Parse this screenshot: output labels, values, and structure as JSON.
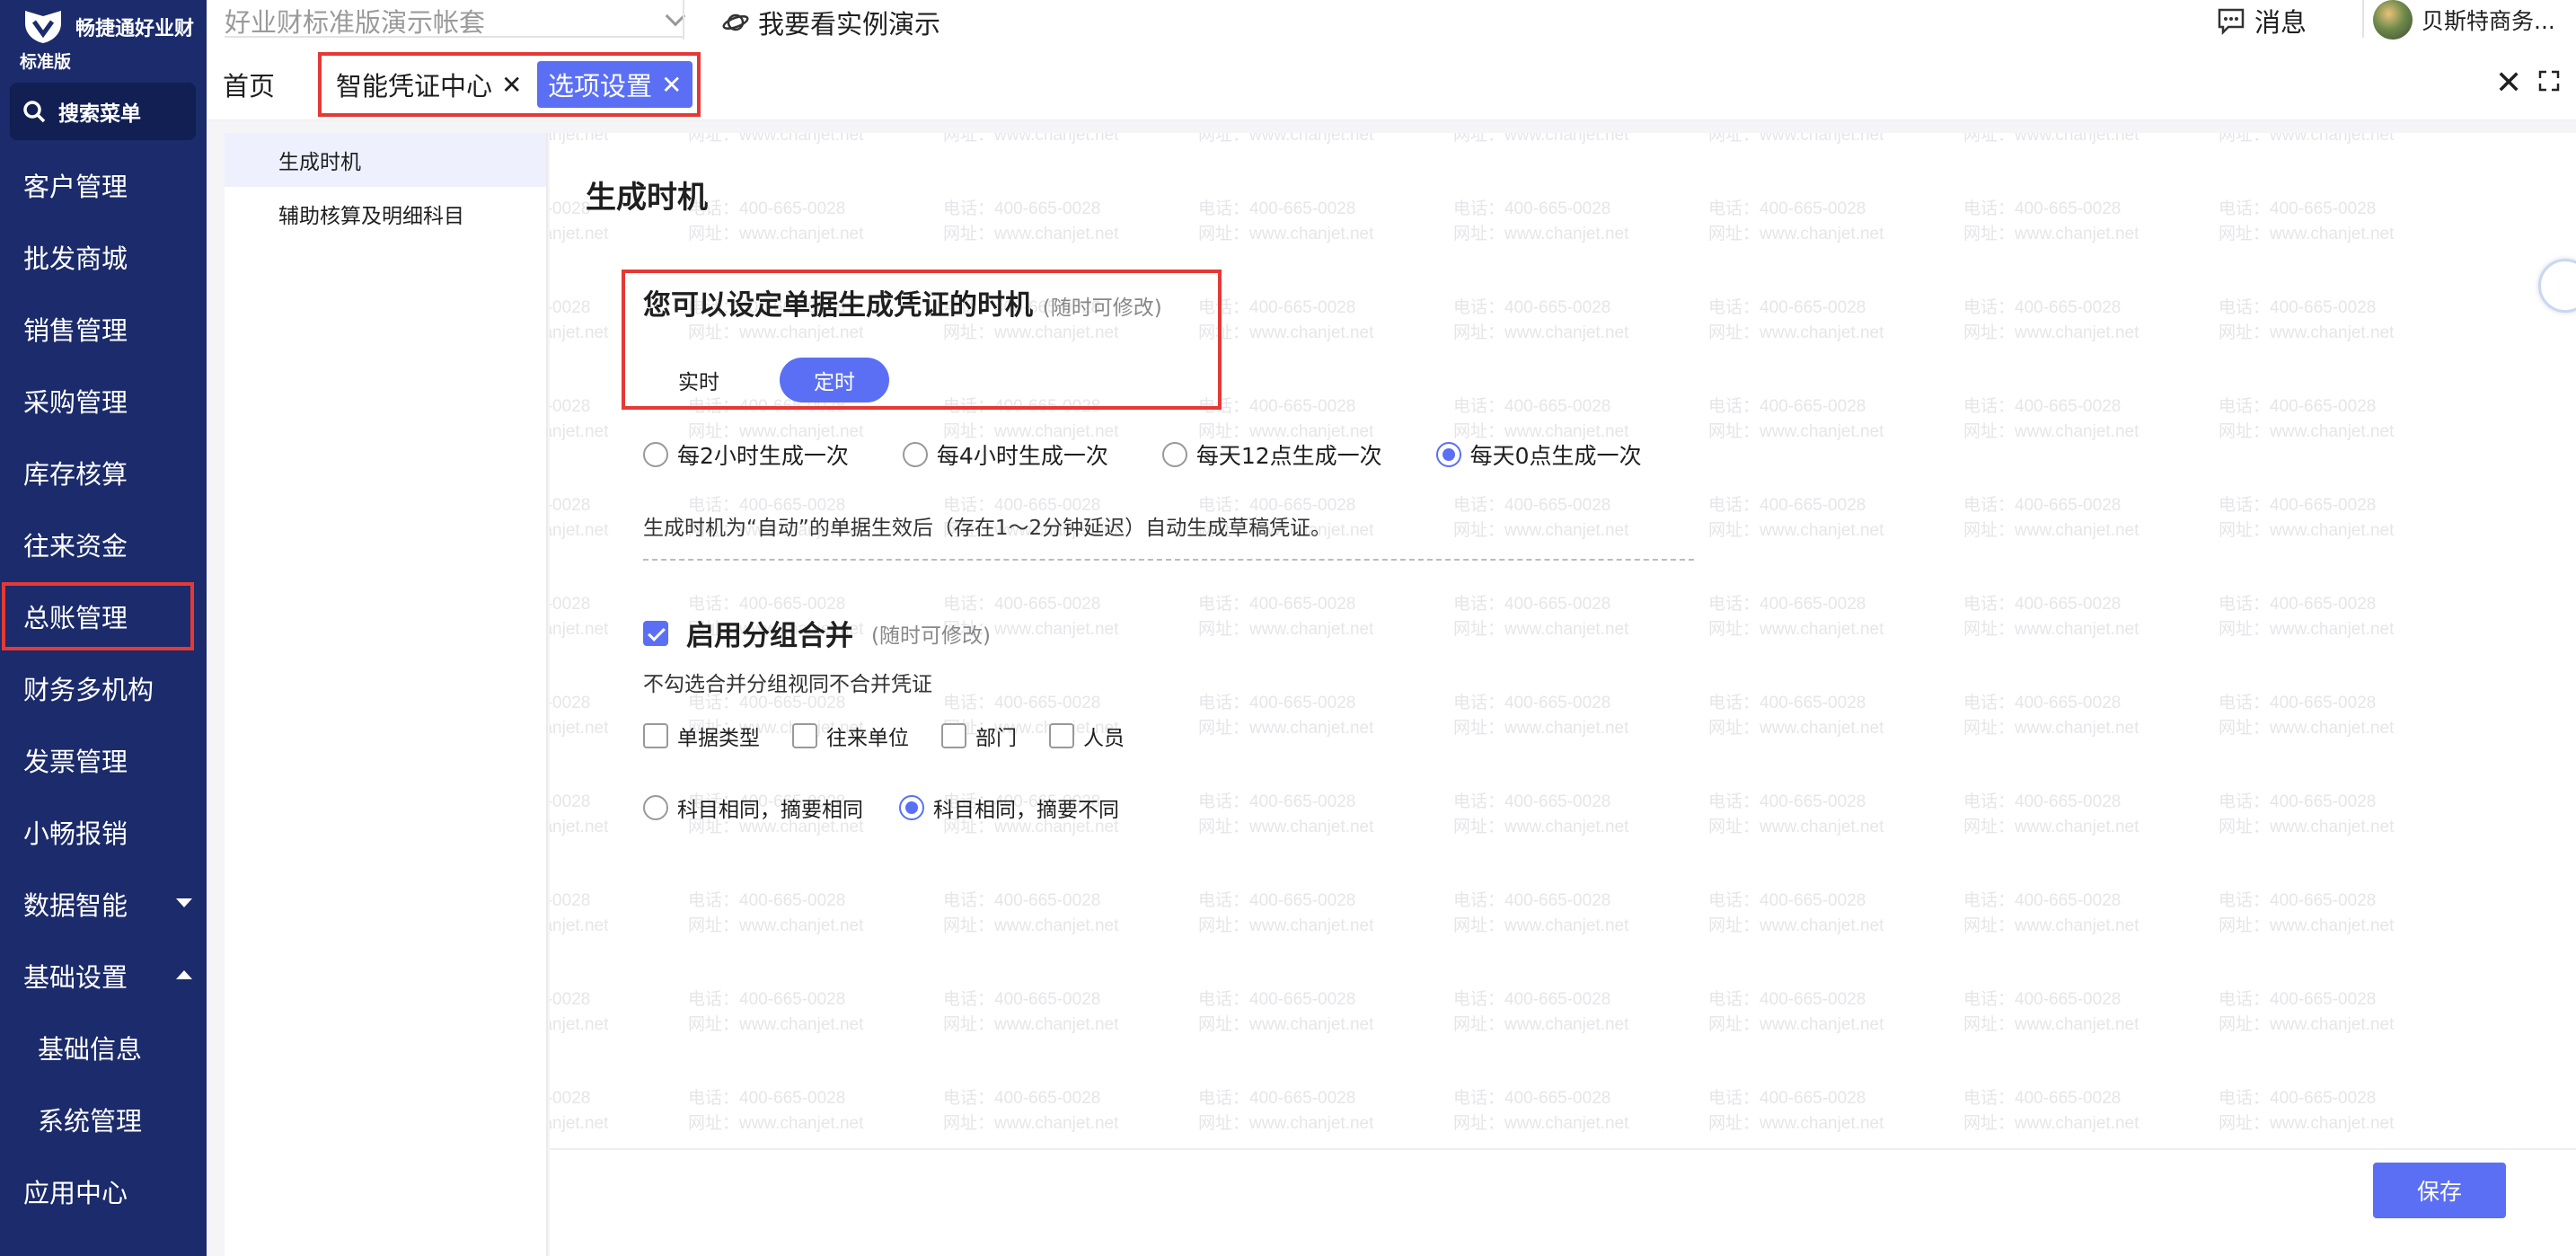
{
  "app": {
    "brand": "畅捷通好业财",
    "edition": "标准版",
    "account": "好业财标准版演示帐套",
    "demo_link": "我要看实例演示",
    "messages_label": "消息",
    "user_name": "贝斯特商务..."
  },
  "sidebar": {
    "search_label": "搜索菜单",
    "items": [
      {
        "label": "客户管理"
      },
      {
        "label": "批发商城"
      },
      {
        "label": "销售管理"
      },
      {
        "label": "采购管理"
      },
      {
        "label": "库存核算"
      },
      {
        "label": "往来资金"
      },
      {
        "label": "总账管理",
        "active": true
      },
      {
        "label": "财务多机构"
      },
      {
        "label": "发票管理"
      },
      {
        "label": "小畅报销"
      },
      {
        "label": "数据智能",
        "caret": "down"
      },
      {
        "label": "基础设置",
        "caret": "up"
      },
      {
        "label": "基础信息",
        "sub": true
      },
      {
        "label": "系统管理",
        "sub": true
      },
      {
        "label": "应用中心"
      }
    ]
  },
  "tabs": [
    {
      "label": "首页",
      "closable": false
    },
    {
      "label": "智能凭证中心",
      "closable": true
    },
    {
      "label": "选项设置",
      "closable": true,
      "active": true
    }
  ],
  "options_nav": [
    {
      "label": "生成时机",
      "active": true
    },
    {
      "label": "辅助核算及明细科目"
    }
  ],
  "timing": {
    "section_title": "生成时机",
    "title": "您可以设定单据生成凭证的时机",
    "note": "(随时可修改)",
    "mode_realtime": "实时",
    "mode_scheduled": "定时",
    "schedule_options": [
      {
        "label": "每2小时生成一次",
        "selected": false
      },
      {
        "label": "每4小时生成一次",
        "selected": false
      },
      {
        "label": "每天12点生成一次",
        "selected": false
      },
      {
        "label": "每天0点生成一次",
        "selected": true
      }
    ],
    "description": "生成时机为“自动”的单据生效后（存在1～2分钟延迟）自动生成草稿凭证。"
  },
  "merge": {
    "title": "启用分组合并",
    "note": "(随时可修改)",
    "enabled": true,
    "description": "不勾选合并分组视同不合并凭证",
    "fields": [
      {
        "label": "单据类型",
        "checked": false
      },
      {
        "label": "往来单位",
        "checked": false
      },
      {
        "label": "部门",
        "checked": false
      },
      {
        "label": "人员",
        "checked": false
      }
    ],
    "rules": [
      {
        "label": "科目相同，摘要相同",
        "selected": false
      },
      {
        "label": "科目相同，摘要不同",
        "selected": true
      }
    ]
  },
  "watermark": {
    "phone": "电话：400-665-0028",
    "site": "网址：www.chanjet.net"
  },
  "actions": {
    "save": "保存"
  },
  "colors": {
    "sidebar": "#1b2b6b",
    "accent": "#5b6ff5",
    "highlight": "#e53935"
  }
}
